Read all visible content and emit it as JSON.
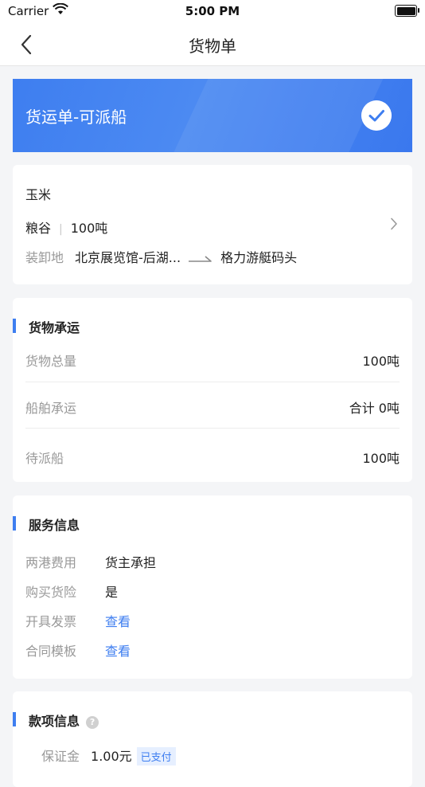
{
  "status_bar": {
    "carrier": "Carrier",
    "time": "5:00 PM"
  },
  "nav": {
    "title": "货物单"
  },
  "banner": {
    "label": "货运单-可派船"
  },
  "goods": {
    "name": "玉米",
    "category": "粮谷",
    "separator": "|",
    "quantity": "100吨",
    "route_label": "装卸地",
    "origin": "北京展览馆-后湖...",
    "destination": "格力游艇码头"
  },
  "carriage": {
    "title": "货物承运",
    "rows": [
      {
        "label": "货物总量",
        "value": "100吨"
      },
      {
        "label": "船舶承运",
        "value": "合计 0吨"
      },
      {
        "label": "待派船",
        "value": "100吨"
      }
    ]
  },
  "service": {
    "title": "服务信息",
    "rows": [
      {
        "label": "两港费用",
        "value": "货主承担"
      },
      {
        "label": "购买货险",
        "value": "是"
      },
      {
        "label": "开具发票",
        "value": "查看"
      },
      {
        "label": "合同模板",
        "value": "查看"
      }
    ]
  },
  "payment": {
    "title": "款项信息",
    "help": "?",
    "deposit_label": "保证金",
    "deposit_value": "1.00元",
    "deposit_status": "已支付"
  },
  "colors": {
    "accent": "#3e7ef0",
    "banner": "#4384f0"
  }
}
